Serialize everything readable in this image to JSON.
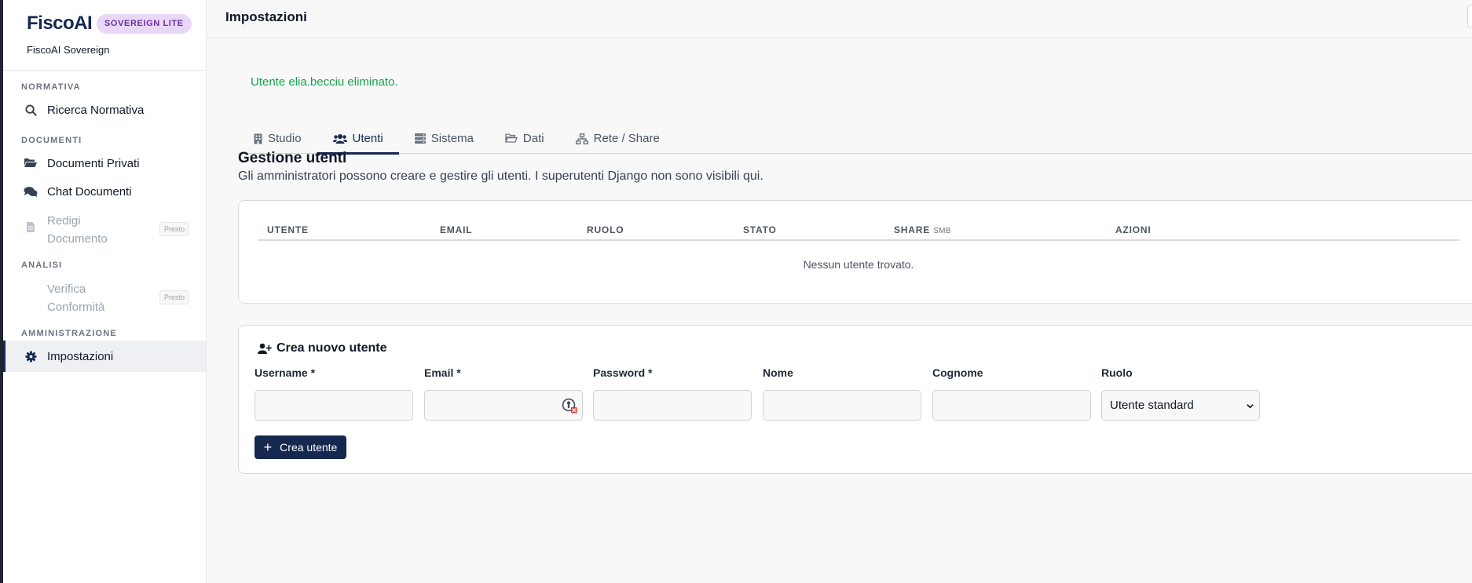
{
  "sidebar": {
    "logo_text": "FiscoAI",
    "badge": "SOVEREIGN LITE",
    "subtitle": "FiscoAI Sovereign",
    "sections": {
      "normativa": "NORMATIVA",
      "documenti": "DOCUMENTI",
      "analisi": "ANALISI",
      "amministrazione": "AMMINISTRAZIONE"
    },
    "items": {
      "ricerca": {
        "label": "Ricerca Normativa",
        "icon": "search-icon"
      },
      "documenti_privati": {
        "label": "Documenti Privati",
        "icon": "folder-open-icon"
      },
      "chat_documenti": {
        "label": "Chat Documenti",
        "icon": "chat-icon"
      },
      "redigi": {
        "label": "Redigi Documento",
        "icon": "document-icon",
        "tag": "Presto"
      },
      "verifica": {
        "label": "Verifica Conformità",
        "icon": "check-icon",
        "tag": "Presto"
      },
      "impostazioni": {
        "label": "Impostazioni",
        "icon": "gear-icon"
      }
    }
  },
  "topbar": {
    "title": "Impostazioni"
  },
  "alert": {
    "message": "Utente elia.becciu eliminato.",
    "color": "#16a34a"
  },
  "tabs": [
    {
      "label": "Studio",
      "icon": "building-icon"
    },
    {
      "label": "Utenti",
      "icon": "users-icon",
      "active": true
    },
    {
      "label": "Sistema",
      "icon": "server-icon"
    },
    {
      "label": "Dati",
      "icon": "folder-open-icon"
    },
    {
      "label": "Rete / Share",
      "icon": "network-icon"
    }
  ],
  "users_section": {
    "title": "Gestione utenti",
    "description": "Gli amministratori possono creare e gestire gli utenti. I superutenti Django non sono visibili qui.",
    "columns": {
      "utente": "UTENTE",
      "email": "EMAIL",
      "ruolo": "RUOLO",
      "stato": "STATO",
      "share": "SHARE",
      "share_suffix": "SMB",
      "azioni": "AZIONI"
    },
    "empty_message": "Nessun utente trovato."
  },
  "create_form": {
    "title": "Crea nuovo utente",
    "fields": {
      "username": {
        "label": "Username *",
        "value": ""
      },
      "email": {
        "label": "Email *",
        "value": ""
      },
      "password": {
        "label": "Password *",
        "value": ""
      },
      "nome": {
        "label": "Nome",
        "value": ""
      },
      "cognome": {
        "label": "Cognome",
        "value": ""
      },
      "ruolo": {
        "label": "Ruolo",
        "value": "Utente standard"
      }
    },
    "submit_label": "Crea utente"
  },
  "colors": {
    "accent": "#142850",
    "badge_bg": "#e9d8f5",
    "badge_text": "#6b2fa3",
    "success": "#16a34a"
  }
}
